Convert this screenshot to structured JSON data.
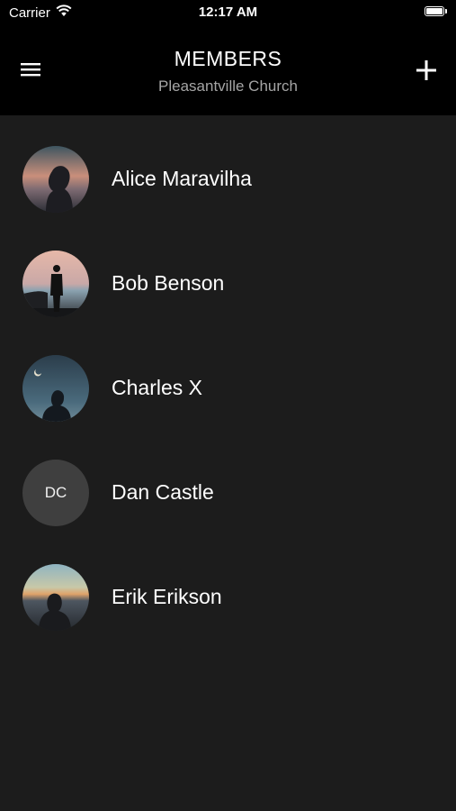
{
  "status_bar": {
    "carrier": "Carrier",
    "time": "12:17 AM",
    "wifi_icon": "wifi-icon",
    "battery_icon": "battery-icon"
  },
  "nav": {
    "title": "MEMBERS",
    "subtitle": "Pleasantville Church",
    "menu_icon": "hamburger-menu-icon",
    "add_icon": "plus-icon"
  },
  "members": [
    {
      "name": "Alice Maravilha",
      "avatar": "photo"
    },
    {
      "name": "Bob Benson",
      "avatar": "photo"
    },
    {
      "name": "Charles X",
      "avatar": "photo"
    },
    {
      "name": "Dan Castle",
      "avatar": "initials",
      "initials": "DC"
    },
    {
      "name": "Erik Erikson",
      "avatar": "photo"
    }
  ],
  "colors": {
    "background": "#1c1c1c",
    "header": "#000000",
    "subtitle": "#a5a5a5",
    "initials_avatar": "#3f3f3f"
  }
}
